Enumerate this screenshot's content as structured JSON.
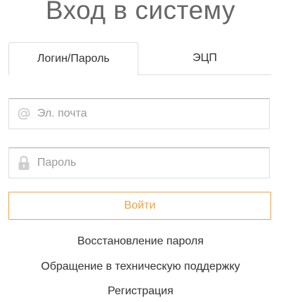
{
  "page": {
    "title": "Вход в систему"
  },
  "tabs": [
    {
      "label": "Логин/Пароль",
      "active": true
    },
    {
      "label": "ЭЦП",
      "active": false
    }
  ],
  "form": {
    "email": {
      "value": "",
      "placeholder": "Эл. почта",
      "icon": "at-icon"
    },
    "password": {
      "value": "",
      "placeholder": "Пароль",
      "icon": "lock-icon"
    },
    "submit_label": "Войти"
  },
  "links": {
    "restore_password": "Восстановление пароля",
    "support": "Обращение в техническую поддержку",
    "register": "Регистрация"
  },
  "colors": {
    "accent": "#f0a14a",
    "title": "#666666",
    "border": "#dddddd",
    "placeholder": "#9a9a9a"
  }
}
